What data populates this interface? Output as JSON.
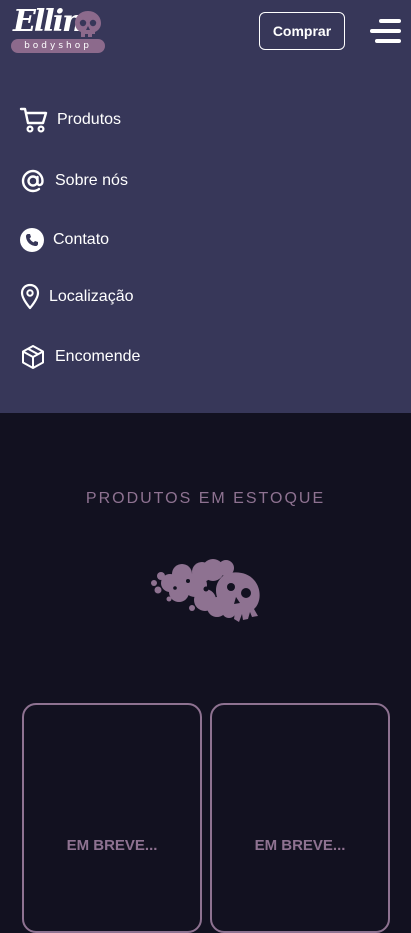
{
  "header": {
    "logo_text": "Ellin",
    "logo_tagline": "bodyshop",
    "buy_label": "Comprar"
  },
  "nav": [
    {
      "label": "Produtos",
      "icon": "cart-icon"
    },
    {
      "label": "Sobre nós",
      "icon": "at-icon"
    },
    {
      "label": "Contato",
      "icon": "phone-icon"
    },
    {
      "label": "Localização",
      "icon": "location-pin-icon"
    },
    {
      "label": "Encomende",
      "icon": "package-icon"
    }
  ],
  "products": {
    "title": "PRODUTOS EM ESTOQUE",
    "cards": [
      {
        "label": "EM BREVE..."
      },
      {
        "label": "EM BREVE..."
      }
    ]
  },
  "colors": {
    "header_bg": "#373759",
    "page_bg": "#121120",
    "accent": "#8e7291"
  }
}
